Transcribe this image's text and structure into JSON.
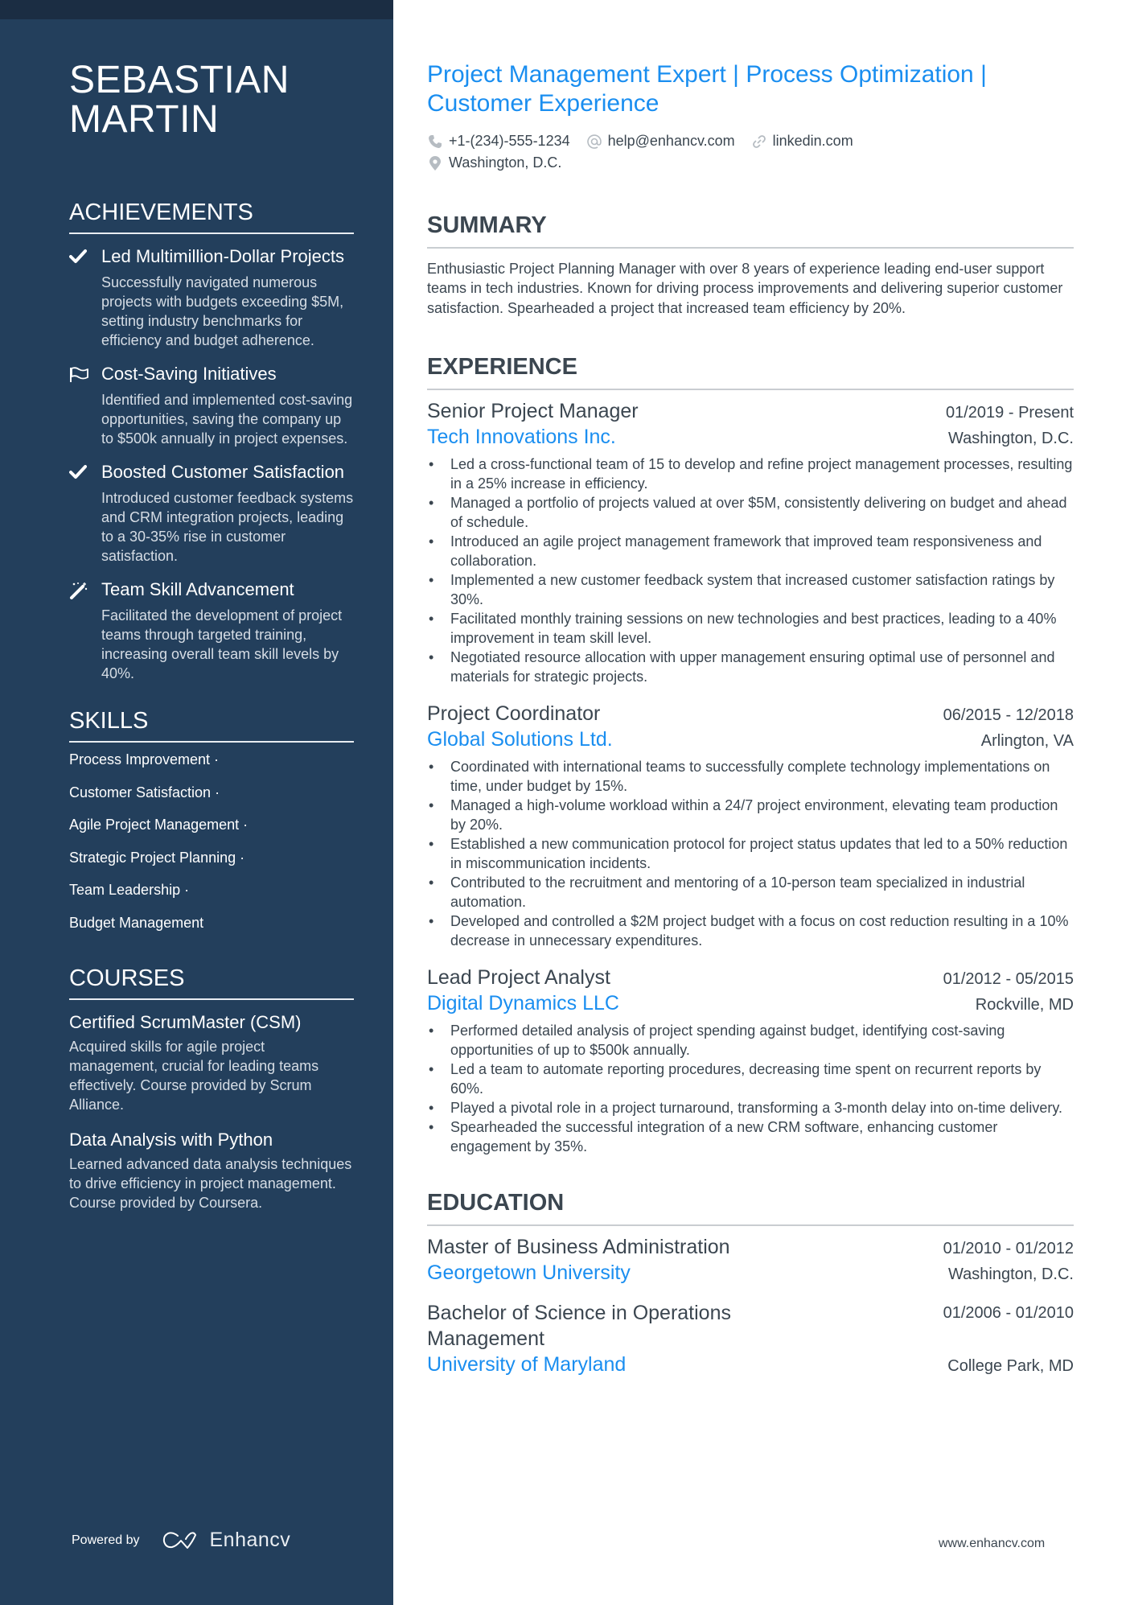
{
  "person": {
    "name_line1": "SEBASTIAN",
    "name_line2": "MARTIN",
    "headline": "Project Management Expert | Process Optimization | Customer Experience",
    "contacts": {
      "phone": "+1-(234)-555-1234",
      "email": "help@enhancv.com",
      "link": "linkedin.com",
      "location": "Washington, D.C."
    }
  },
  "sidebar": {
    "achievements": {
      "heading": "ACHIEVEMENTS",
      "items": [
        {
          "icon": "check-icon",
          "title": "Led Multimillion-Dollar Projects",
          "desc": "Successfully navigated numerous projects with budgets exceeding $5M, setting industry benchmarks for efficiency and budget adherence."
        },
        {
          "icon": "flag-icon",
          "title": "Cost-Saving Initiatives",
          "desc": "Identified and implemented cost-saving opportunities, saving the company up to $500k annually in project expenses."
        },
        {
          "icon": "check-icon",
          "title": "Boosted Customer Satisfaction",
          "desc": "Introduced customer feedback systems and CRM integration projects, leading to a 30-35% rise in customer satisfaction."
        },
        {
          "icon": "magic-wand-icon",
          "title": "Team Skill Advancement",
          "desc": "Facilitated the development of project teams through targeted training, increasing overall team skill levels by 40%."
        }
      ]
    },
    "skills": {
      "heading": "SKILLS",
      "items": [
        "Process Improvement ·",
        "Customer Satisfaction ·",
        "Agile Project Management ·",
        "Strategic Project Planning ·",
        "Team Leadership ·",
        "Budget Management"
      ]
    },
    "courses": {
      "heading": "COURSES",
      "items": [
        {
          "title": "Certified ScrumMaster (CSM)",
          "desc": "Acquired skills for agile project management, crucial for leading teams effectively. Course provided by Scrum Alliance."
        },
        {
          "title": "Data Analysis with Python",
          "desc": "Learned advanced data analysis techniques to drive efficiency in project management. Course provided by Coursera."
        }
      ]
    },
    "footer": {
      "powered_by": "Powered by",
      "brand": "Enhancv"
    }
  },
  "summary": {
    "heading": "SUMMARY",
    "text": "Enthusiastic Project Planning Manager with over 8 years of experience leading end-user support teams in tech industries. Known for driving process improvements and delivering superior customer satisfaction. Spearheaded a project that increased team efficiency by 20%."
  },
  "experience": {
    "heading": "EXPERIENCE",
    "jobs": [
      {
        "role": "Senior Project Manager",
        "dates": "01/2019 - Present",
        "company": "Tech Innovations Inc.",
        "location": "Washington, D.C.",
        "bullets": [
          "Led a cross-functional team of 15 to develop and refine project management processes, resulting in a 25% increase in efficiency.",
          "Managed a portfolio of projects valued at over $5M, consistently delivering on budget and ahead of schedule.",
          "Introduced an agile project management framework that improved team responsiveness and collaboration.",
          "Implemented a new customer feedback system that increased customer satisfaction ratings by 30%.",
          "Facilitated monthly training sessions on new technologies and best practices, leading to a 40% improvement in team skill level.",
          "Negotiated resource allocation with upper management ensuring optimal use of personnel and materials for strategic projects."
        ]
      },
      {
        "role": "Project Coordinator",
        "dates": "06/2015 - 12/2018",
        "company": "Global Solutions Ltd.",
        "location": "Arlington, VA",
        "bullets": [
          "Coordinated with international teams to successfully complete technology implementations on time, under budget by 15%.",
          "Managed a high-volume workload within a 24/7 project environment, elevating team production by 20%.",
          "Established a new communication protocol for project status updates that led to a 50% reduction in miscommunication incidents.",
          "Contributed to the recruitment and mentoring of a 10-person team specialized in industrial automation.",
          "Developed and controlled a $2M project budget with a focus on cost reduction resulting in a 10% decrease in unnecessary expenditures."
        ]
      },
      {
        "role": "Lead Project Analyst",
        "dates": "01/2012 - 05/2015",
        "company": "Digital Dynamics LLC",
        "location": "Rockville, MD",
        "bullets": [
          "Performed detailed analysis of project spending against budget, identifying cost-saving opportunities of up to $500k annually.",
          "Led a team to automate reporting procedures, decreasing time spent on recurrent reports by 60%.",
          "Played a pivotal role in a project turnaround, transforming a 3-month delay into on-time delivery.",
          "Spearheaded the successful integration of a new CRM software, enhancing customer engagement by 35%."
        ]
      }
    ]
  },
  "education": {
    "heading": "EDUCATION",
    "items": [
      {
        "degree": "Master of Business Administration",
        "dates": "01/2010 - 01/2012",
        "school": "Georgetown University",
        "location": "Washington, D.C."
      },
      {
        "degree": "Bachelor of Science in Operations Management",
        "dates": "01/2006 - 01/2010",
        "school": "University of Maryland",
        "location": "College Park, MD"
      }
    ]
  },
  "footer": {
    "website": "www.enhancv.com"
  },
  "colors": {
    "sidebar": "#233f5c",
    "sidebar_top": "#1b2d43",
    "accent": "#1a8ef0",
    "text": "#3b4650"
  }
}
